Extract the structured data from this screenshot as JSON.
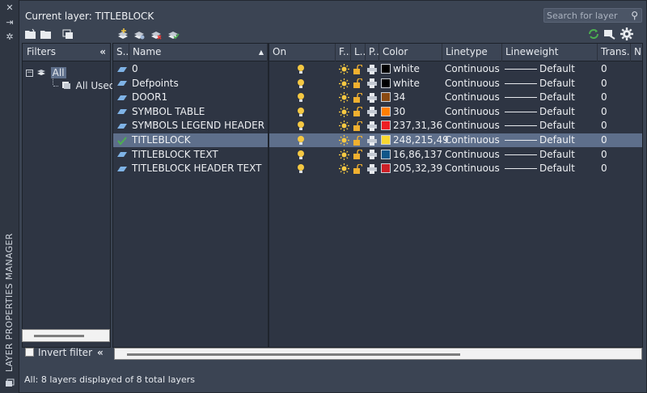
{
  "window": {
    "vertical_title": "LAYER PROPERTIES MANAGER"
  },
  "header": {
    "current_layer_text": "Current layer: TITLEBLOCK",
    "search_placeholder": "Search for layer"
  },
  "filters": {
    "title": "Filters",
    "tree": [
      {
        "label": "All",
        "selected": true
      },
      {
        "label": "All Used La"
      }
    ],
    "invert_filter_label": "Invert filter",
    "invert_filter_checked": false
  },
  "columns": [
    "S...",
    "Name",
    "On",
    "F...",
    "L...",
    "P...",
    "Color",
    "Linetype",
    "Lineweight",
    "Trans...",
    "N"
  ],
  "layers": [
    {
      "current": false,
      "name": "0",
      "color_name": "white",
      "color_hex": "#000000",
      "linetype": "Continuous",
      "lineweight": "Default",
      "transparency": "0"
    },
    {
      "current": false,
      "name": "Defpoints",
      "color_name": "white",
      "color_hex": "#000000",
      "linetype": "Continuous",
      "lineweight": "Default",
      "transparency": "0"
    },
    {
      "current": false,
      "name": "DOOR1",
      "color_name": "34",
      "color_hex": "#8a4a12",
      "linetype": "Continuous",
      "lineweight": "Default",
      "transparency": "0"
    },
    {
      "current": false,
      "name": "SYMBOL TABLE",
      "color_name": "30",
      "color_hex": "#ff7f00",
      "linetype": "Continuous",
      "lineweight": "Default",
      "transparency": "0"
    },
    {
      "current": false,
      "name": "SYMBOLS LEGEND HEADER",
      "color_name": "237,31,36",
      "color_hex": "#ed1f24",
      "linetype": "Continuous",
      "lineweight": "Default",
      "transparency": "0"
    },
    {
      "current": true,
      "name": "TITLEBLOCK",
      "color_name": "248,215,49",
      "color_hex": "#f8d731",
      "linetype": "Continuous",
      "lineweight": "Default",
      "transparency": "0"
    },
    {
      "current": false,
      "name": "TITLEBLOCK TEXT",
      "color_name": "16,86,137",
      "color_hex": "#105689",
      "linetype": "Continuous",
      "lineweight": "Default",
      "transparency": "0"
    },
    {
      "current": false,
      "name": "TITLEBLOCK HEADER TEXT",
      "color_name": "205,32,39",
      "color_hex": "#cd2027",
      "linetype": "Continuous",
      "lineweight": "Default",
      "transparency": "0"
    }
  ],
  "status": {
    "text": "All: 8 layers displayed of 8 total layers"
  },
  "colors": {
    "accent_green": "#4caf50",
    "selected_row": "#5e6f8b",
    "bulb": "#f5c842",
    "sun": "#f5c842",
    "lock": "#f0b030"
  }
}
